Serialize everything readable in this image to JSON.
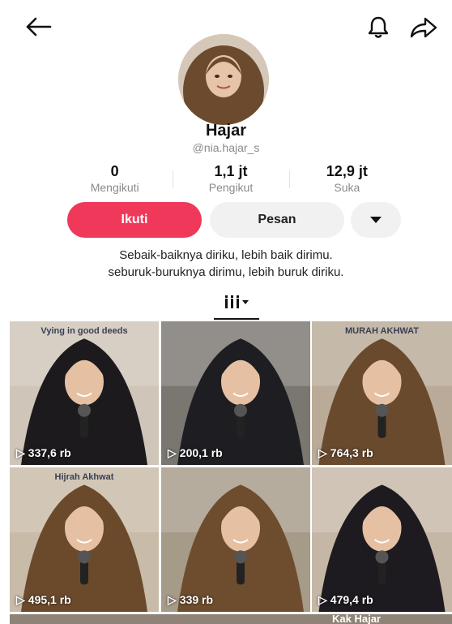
{
  "profile": {
    "name": "Hajar",
    "handle": "@nia.hajar_s",
    "bio_line1": "Sebaik-baiknya diriku, lebih baik dirimu.",
    "bio_line2": "seburuk-buruknya dirimu, lebih buruk diriku."
  },
  "stats": [
    {
      "value": "0",
      "label": "Mengikuti"
    },
    {
      "value": "1,1 jt",
      "label": "Pengikut"
    },
    {
      "value": "12,9 jt",
      "label": "Suka"
    }
  ],
  "actions": {
    "follow_label": "Ikuti",
    "message_label": "Pesan"
  },
  "icons": {
    "back": "arrow-left-icon",
    "bell": "bell-icon",
    "share": "share-arrow-icon",
    "more": "caret-down-icon",
    "grid_tab": "grid-columns-icon"
  },
  "colors": {
    "accent": "#f0385a",
    "button_gray": "#f1f1f2",
    "muted_text": "#8a8a8a"
  },
  "videos": [
    {
      "views": "337,6 rb",
      "scene_text": "Vying in good deeds",
      "hijab": "#1c1a1d",
      "bg": "#cfc5b8"
    },
    {
      "views": "200,1 rb",
      "scene_text": "",
      "hijab": "#1e1d22",
      "bg": "#7a7670"
    },
    {
      "views": "764,3 rb",
      "scene_text": "MURAH AKHWAT",
      "hijab": "#6a4a2d",
      "bg": "#b9ab98"
    },
    {
      "views": "495,1 rb",
      "scene_text": "Hijrah Akhwat",
      "hijab": "#6b4a2c",
      "bg": "#c8bba8"
    },
    {
      "views": "339 rb",
      "scene_text": "",
      "hijab": "#6e4d2e",
      "bg": "#a69a89"
    },
    {
      "views": "479,4 rb",
      "scene_text": "",
      "hijab": "#1d1b1f",
      "bg": "#c5b7a5"
    }
  ],
  "bottom_peek_text": "Kak Hajar"
}
